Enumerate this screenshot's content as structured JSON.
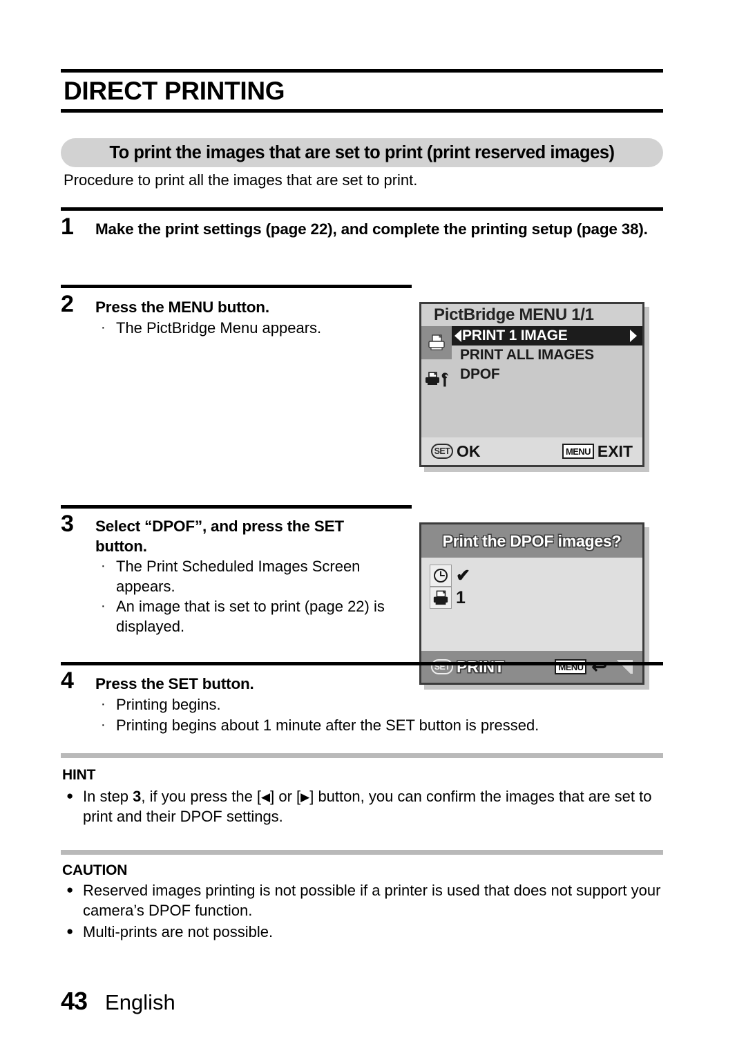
{
  "header": {
    "chapter_title": "DIRECT PRINTING",
    "section_title": "To print the images that are set to print (print reserved images)",
    "intro": "Procedure to print all the images that are set to print."
  },
  "steps": [
    {
      "number": "1",
      "title": "Make the print settings (page 22), and complete the printing setup (page 38).",
      "bullets": []
    },
    {
      "number": "2",
      "title": "Press the MENU button.",
      "bullets": [
        "The PictBridge Menu appears."
      ]
    },
    {
      "number": "3",
      "title": "Select “DPOF”, and press the SET button.",
      "bullets": [
        "The Print Scheduled Images Screen appears.",
        "An image that is set to print (page 22) is displayed."
      ]
    },
    {
      "number": "4",
      "title": "Press the SET button.",
      "bullets": [
        "Printing begins.",
        "Printing begins about 1 minute after the SET button is pressed."
      ]
    }
  ],
  "screen1": {
    "title": "PictBridge MENU 1/1",
    "icons": [
      "printer-icon",
      "printer-setup-icon"
    ],
    "menu_items": [
      "PRINT 1 IMAGE",
      "PRINT ALL IMAGES",
      "DPOF"
    ],
    "selected_index": 0,
    "footer": {
      "set_badge": "SET",
      "set_label": "OK",
      "menu_badge": "MENU",
      "menu_label": "EXIT"
    }
  },
  "screen2": {
    "title": "Print the DPOF images?",
    "rows": [
      {
        "icon": "clock-icon",
        "value": "✔"
      },
      {
        "icon": "printer-icon",
        "value": "1"
      }
    ],
    "footer": {
      "set_badge": "SET",
      "set_label": "PRINT",
      "menu_badge": "MENU",
      "return_icon": "↩"
    }
  },
  "hint": {
    "heading": "HINT",
    "text_before": "In step ",
    "step_ref": "3",
    "text_mid": ", if you press the [",
    "left_arrow": "◀",
    "text_or": "] or [",
    "right_arrow": "▶",
    "text_after": "] button, you can confirm the images that are set to print and their DPOF settings."
  },
  "caution": {
    "heading": "CAUTION",
    "items": [
      "Reserved images printing is not possible if a printer is used that does not support your camera’s DPOF function.",
      "Multi-prints are not possible."
    ]
  },
  "footer": {
    "page_number": "43",
    "language": "English"
  }
}
